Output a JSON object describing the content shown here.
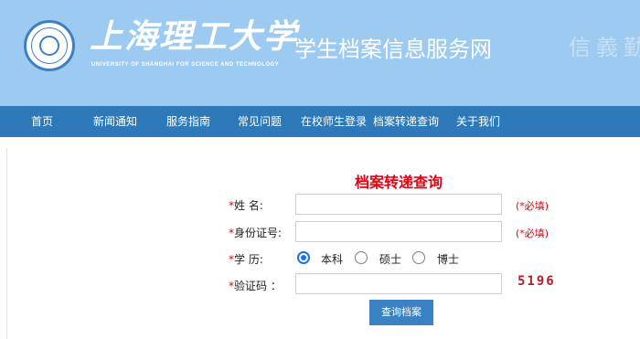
{
  "header": {
    "university_name_cn": "上海理工大学",
    "university_name_en": "UNIVERSITY OF SHANGHAI FOR SCIENCE AND TECHNOLOGY",
    "site_title": "学生档案信息服务网",
    "motto": "信義勤",
    "logo_icon": "university-seal-icon"
  },
  "nav": {
    "items": [
      {
        "label": "首页"
      },
      {
        "label": "新闻通知"
      },
      {
        "label": "服务指南"
      },
      {
        "label": "常见问题"
      },
      {
        "label": "在校师生登录"
      },
      {
        "label": "档案转递查询"
      },
      {
        "label": "关于我们"
      }
    ]
  },
  "form": {
    "title": "档案转递查询",
    "required_mark": "*",
    "name_label": "姓    名:",
    "id_label": "身份证号:",
    "degree_label": "学    历:",
    "captcha_label": "验证码 ：",
    "required_note": "(*必填)",
    "name_value": "",
    "id_value": "",
    "captcha_value": "",
    "degree_options": [
      {
        "label": "本科",
        "selected": true
      },
      {
        "label": "硕士",
        "selected": false
      },
      {
        "label": "博士",
        "selected": false
      }
    ],
    "captcha_code": "5196",
    "submit_label": "查询档案"
  },
  "colors": {
    "header_bg": "#9dcaf1",
    "nav_bg": "#2e79b9",
    "accent_red": "#e60012",
    "button_bg": "#3a82c4"
  }
}
